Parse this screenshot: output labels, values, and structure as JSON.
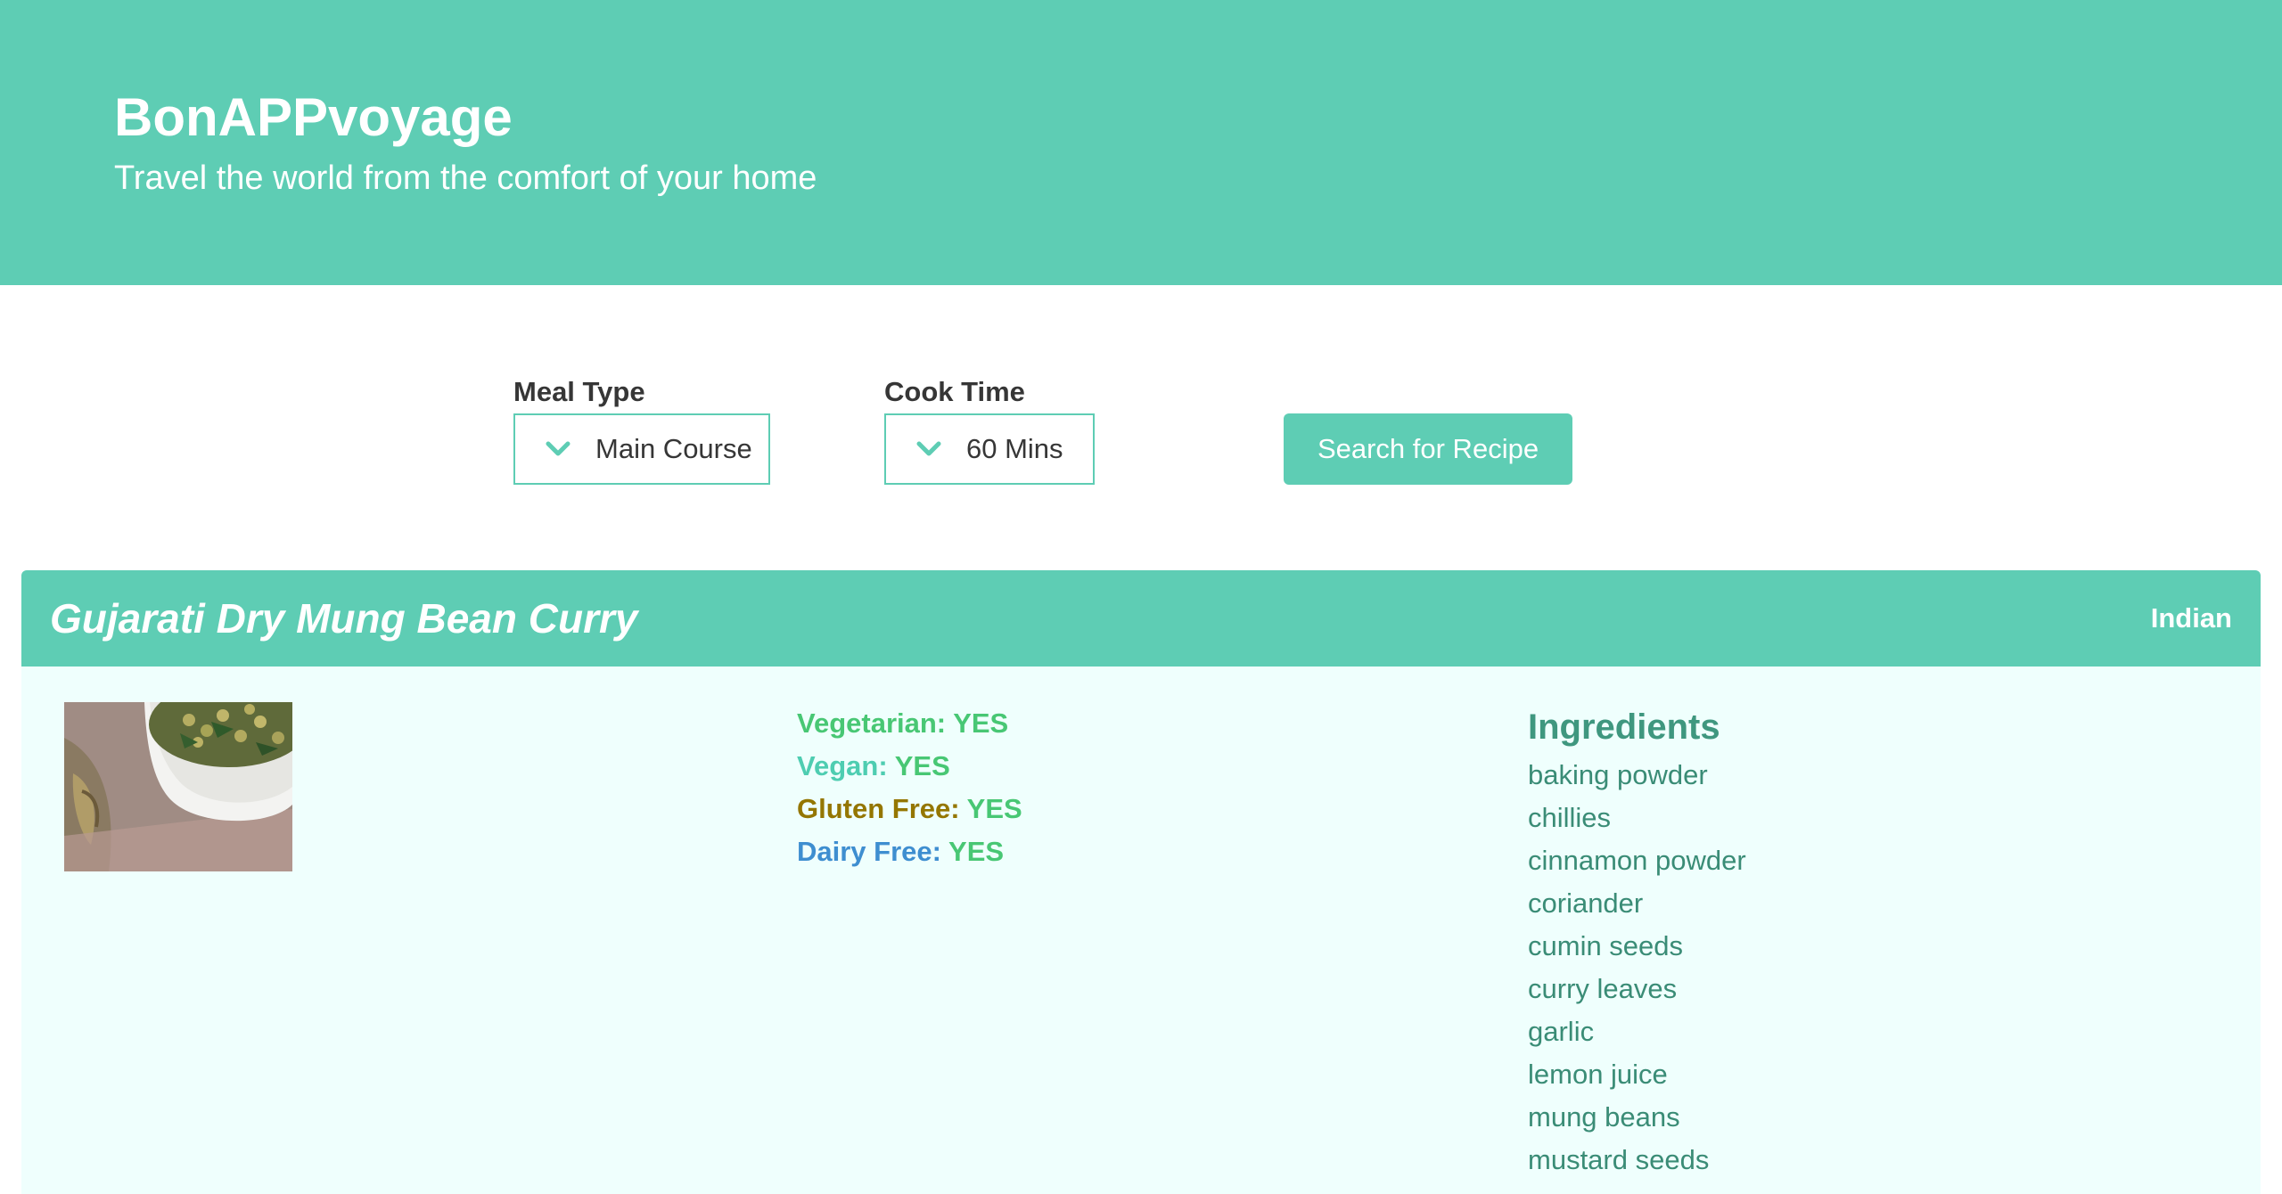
{
  "hero": {
    "title": "BonAPPvoyage",
    "subtitle": "Travel the world from the comfort of your home",
    "background_color": "#5ecdb4"
  },
  "search": {
    "meal_type": {
      "label": "Meal Type",
      "value": "Main Course",
      "icon": "chevron-down-icon"
    },
    "cook_time": {
      "label": "Cook Time",
      "value": "60 Mins",
      "icon": "chevron-down-icon"
    },
    "button_label": "Search for Recipe"
  },
  "recipe": {
    "title": "Gujarati Dry Mung Bean Curry",
    "cuisine": "Indian",
    "image": "mung-bean-curry-bowl",
    "diet": {
      "vegetarian": {
        "label": "Vegetarian:",
        "value": "YES"
      },
      "vegan": {
        "label": "Vegan:",
        "value": "YES"
      },
      "gluten_free": {
        "label": "Gluten Free:",
        "value": "YES"
      },
      "dairy_free": {
        "label": "Dairy Free:",
        "value": "YES"
      }
    },
    "ingredients_title": "Ingredients",
    "ingredients": [
      "baking powder",
      "chillies",
      "cinnamon powder",
      "coriander",
      "cumin seeds",
      "curry leaves",
      "garlic",
      "lemon juice",
      "mung beans",
      "mustard seeds"
    ]
  }
}
